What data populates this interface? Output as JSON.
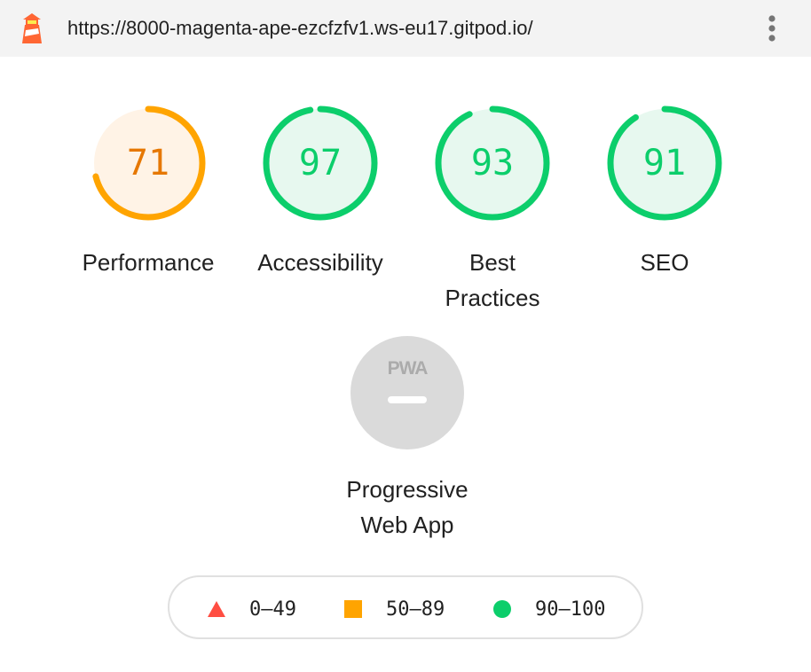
{
  "address_bar": {
    "url": "https://8000-magenta-ape-ezcfzfv1.ws-eu17.gitpod.io/",
    "logo_icon": "lighthouse-icon",
    "menu_icon": "more-vert-icon"
  },
  "gauges": [
    {
      "label": "Performance",
      "score": 71,
      "color": "#ffa400",
      "fill": "#fff3e6"
    },
    {
      "label": "Accessibility",
      "score": 97,
      "color": "#0cce6b",
      "fill": "#e7f8ef"
    },
    {
      "label_lines": [
        "Best",
        "Practices"
      ],
      "score": 93,
      "color": "#0cce6b",
      "fill": "#e7f8ef"
    },
    {
      "label": "SEO",
      "score": 91,
      "color": "#0cce6b",
      "fill": "#e7f8ef"
    }
  ],
  "pwa": {
    "badge_text": "PWA",
    "label_lines": [
      "Progressive",
      "Web App"
    ],
    "color": "#dadada"
  },
  "legend": [
    {
      "range": "0–49",
      "shape": "triangle",
      "color": "#ff4e42"
    },
    {
      "range": "50–89",
      "shape": "square",
      "color": "#ffa400"
    },
    {
      "range": "90–100",
      "shape": "circle",
      "color": "#0cce6b"
    }
  ]
}
